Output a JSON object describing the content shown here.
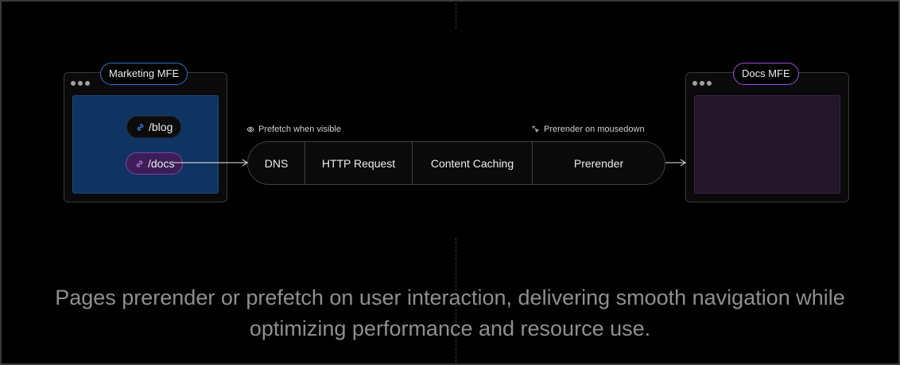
{
  "marketing": {
    "label": "Marketing MFE",
    "links": [
      {
        "text": "/blog"
      },
      {
        "text": "/docs"
      }
    ]
  },
  "docs": {
    "label": "Docs MFE"
  },
  "pipeline": {
    "prefetch_label": "Prefetch when visible",
    "prerender_label": "Prerender on mousedown",
    "stages": [
      "DNS",
      "HTTP Request",
      "Content Caching",
      "Prerender"
    ]
  },
  "caption": {
    "line1": "Pages prerender or prefetch on user interaction, delivering smooth navigation while",
    "line2": "optimizing performance and resource use."
  },
  "colors": {
    "marketing_accent": "#2f6fce",
    "docs_accent": "#9b4fd1",
    "marketing_fill": "#0f3461",
    "docs_fill": "#231629"
  }
}
